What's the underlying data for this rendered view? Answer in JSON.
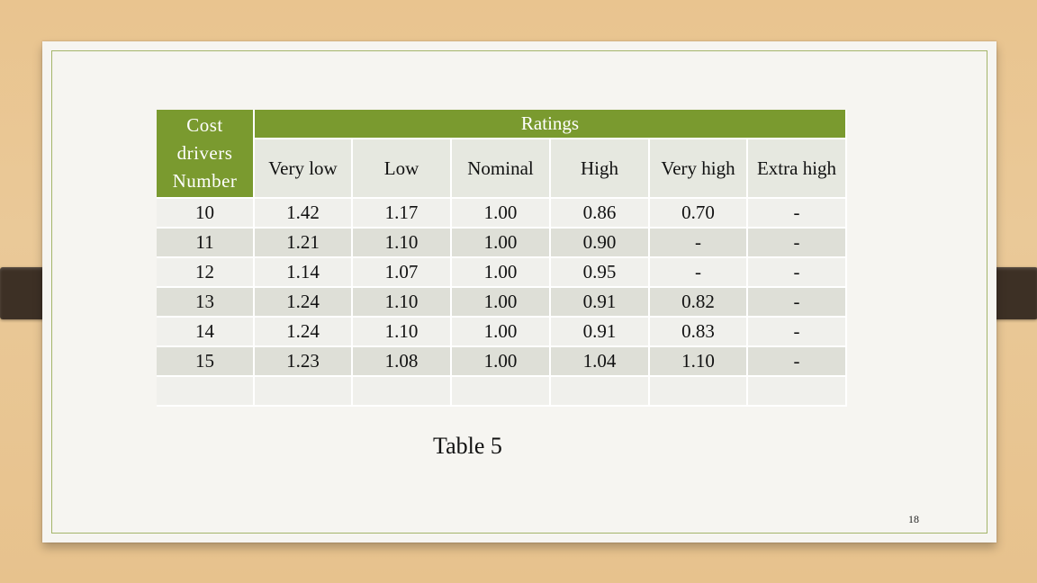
{
  "table": {
    "corner_label": "Cost drivers Number",
    "corner_lines": [
      "Cost",
      "drivers",
      "Number"
    ],
    "group_header": "Ratings",
    "columns": [
      "Very low",
      "Low",
      "Nominal",
      "High",
      "Very high",
      "Extra high"
    ],
    "rows": [
      [
        "10",
        "1.42",
        "1.17",
        "1.00",
        "0.86",
        "0.70",
        "-"
      ],
      [
        "11",
        "1.21",
        "1.10",
        "1.00",
        "0.90",
        "-",
        "-"
      ],
      [
        "12",
        "1.14",
        "1.07",
        "1.00",
        "0.95",
        "-",
        "-"
      ],
      [
        "13",
        "1.24",
        "1.10",
        "1.00",
        "0.91",
        "0.82",
        "-"
      ],
      [
        "14",
        "1.24",
        "1.10",
        "1.00",
        "0.91",
        "0.83",
        "-"
      ],
      [
        "15",
        "1.23",
        "1.08",
        "1.00",
        "1.04",
        "1.10",
        "-"
      ],
      [
        "",
        "",
        "",
        "",
        "",
        "",
        ""
      ]
    ]
  },
  "caption": "Table 5",
  "page_number": "18",
  "colors": {
    "header_green": "#7a9a2f",
    "frame_green": "#a4b56a",
    "row_light": "#f0f0ec",
    "row_dark": "#dedfd7",
    "binder_tab": "#3d3025"
  }
}
